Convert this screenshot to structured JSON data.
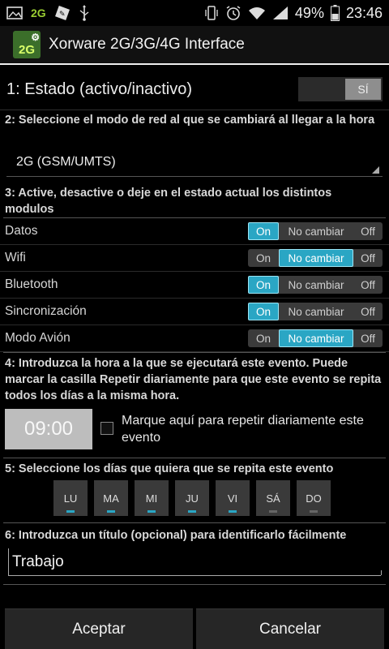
{
  "status_bar": {
    "network": "2G",
    "battery": "49%",
    "time": "23:46"
  },
  "action_bar": {
    "app_icon_text": "2G",
    "title": "Xorware 2G/3G/4G Interface"
  },
  "section1": {
    "label": "1: Estado (activo/inactivo)",
    "toggle_value": "SÍ"
  },
  "section2": {
    "header": "2: Seleccione el modo de red al que se cambiará al llegar a la hora",
    "selected_mode": "2G (GSM/UMTS)"
  },
  "section3": {
    "header": "3: Active, desactive o deje en el estado actual los distintos modulos",
    "options": {
      "on": "On",
      "no_change": "No cambiar",
      "off": "Off"
    },
    "modules": [
      {
        "label": "Datos",
        "selected": "on"
      },
      {
        "label": "Wifi",
        "selected": "no_change"
      },
      {
        "label": "Bluetooth",
        "selected": "on"
      },
      {
        "label": "Sincronización",
        "selected": "on"
      },
      {
        "label": "Modo Avión",
        "selected": "no_change"
      }
    ]
  },
  "section4": {
    "header": "4: Introduzca la hora a la que se ejecutará este evento. Puede marcar la casilla Repetir diariamente para que este evento se repita todos los días a la misma hora.",
    "time": "09:00",
    "repeat_label": "Marque aquí para repetir diariamente este evento",
    "repeat_checked": false
  },
  "section5": {
    "header": "5: Seleccione los días que quiera que se repita este evento",
    "days": [
      {
        "label": "LU",
        "active": true
      },
      {
        "label": "MA",
        "active": true
      },
      {
        "label": "MI",
        "active": true
      },
      {
        "label": "JU",
        "active": true
      },
      {
        "label": "VI",
        "active": true
      },
      {
        "label": "SÁ",
        "active": false
      },
      {
        "label": "DO",
        "active": false
      }
    ]
  },
  "section6": {
    "header": "6: Introduzca un título (opcional) para identificarlo fácilmente",
    "title_value": "Trabajo"
  },
  "buttons": {
    "accept": "Aceptar",
    "cancel": "Cancelar"
  },
  "colors": {
    "accent": "#2aa6c4",
    "network_badge": "#9acd32"
  }
}
